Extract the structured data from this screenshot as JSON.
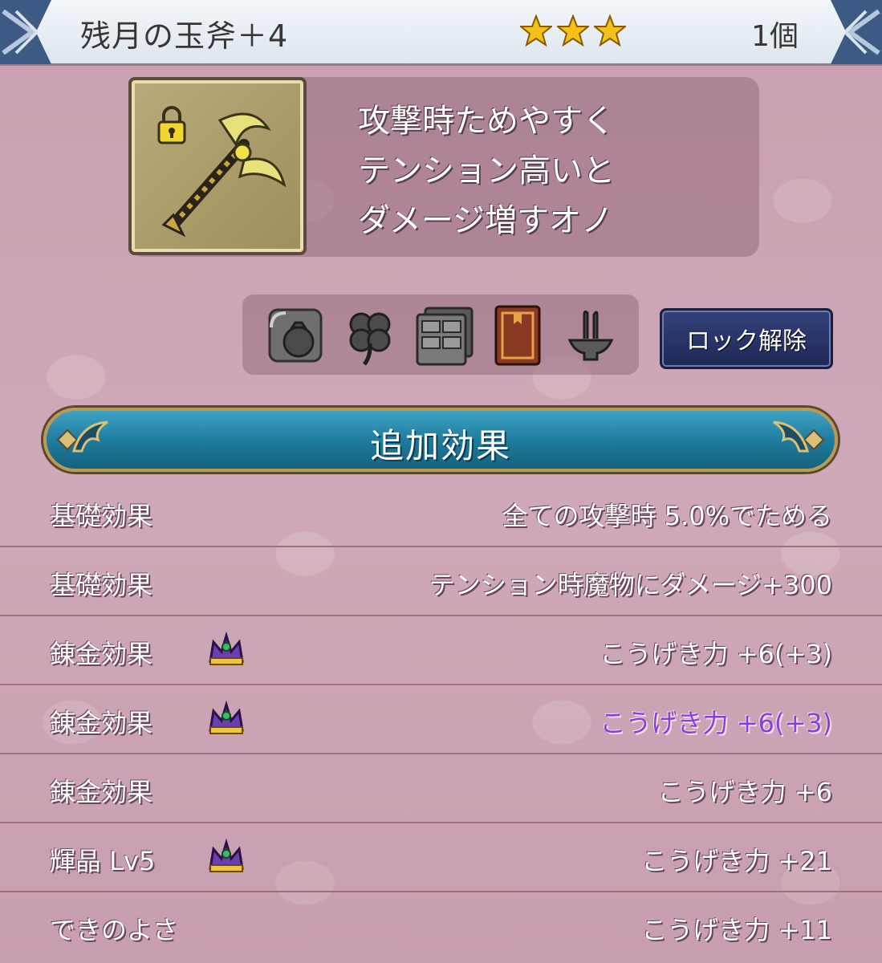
{
  "header": {
    "title": "残月の玉斧＋4",
    "stars": 3,
    "quantity": "1個"
  },
  "item": {
    "icon": "axe-icon",
    "lock_icon": "padlock-icon",
    "description": [
      "攻撃時ためやすく",
      "テンション高いと",
      "ダメージ増すオノ"
    ]
  },
  "actions": {
    "icons": [
      "bag-icon",
      "clover-icon",
      "drawer-icon",
      "book-icon",
      "anvil-icon"
    ],
    "lock_release_label": "ロック解除"
  },
  "section": {
    "title": "追加効果"
  },
  "effects": [
    {
      "label": "基礎効果",
      "value": "全ての攻撃時  5.0%でためる",
      "crown": false,
      "highlight": false
    },
    {
      "label": "基礎効果",
      "value": "テンション時魔物にダメージ+300",
      "crown": false,
      "highlight": false
    },
    {
      "label": "錬金効果",
      "value": "こうげき力  +6(+3)",
      "crown": true,
      "highlight": false
    },
    {
      "label": "錬金効果",
      "value": "こうげき力  +6(+3)",
      "crown": true,
      "highlight": true
    },
    {
      "label": "錬金効果",
      "value": "こうげき力  +6",
      "crown": false,
      "highlight": false
    },
    {
      "label": "輝晶  Lv5",
      "value": "こうげき力  +21",
      "crown": true,
      "highlight": false
    },
    {
      "label": "できのよさ",
      "value": "こうげき力  +11",
      "crown": false,
      "highlight": false
    }
  ],
  "colors": {
    "highlight": "#8b3fd8",
    "banner": "#1f7c9e",
    "button": "#1e2856"
  }
}
